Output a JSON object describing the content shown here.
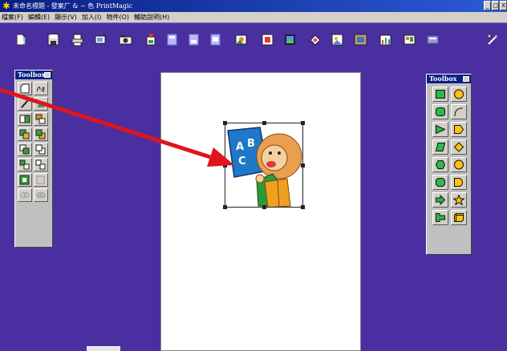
{
  "window": {
    "title": "未命名標題 - 發案厂 & ~ 色 PrintMagic",
    "controls": [
      "_",
      "□",
      "X"
    ]
  },
  "menu": [
    "檔案(F)",
    "編輯(E)",
    "顯示(V)",
    "加入(I)",
    "物件(O)",
    "輔助說明(H)"
  ],
  "toolbar": {
    "icons": [
      "new-icon",
      "save-icon",
      "print-icon",
      "scan-icon",
      "camera-icon",
      "paint-icon",
      "doc-icon",
      "doc2-icon",
      "doc3-icon",
      "photo-icon",
      "frame-icon",
      "image-icon",
      "sticker-icon",
      "picture-icon",
      "frame2-icon",
      "chart-icon",
      "card-icon",
      "banner-icon",
      "magic-icon"
    ]
  },
  "left_toolbox": {
    "title": "Toolbox"
  },
  "right_toolbox": {
    "title": "Toolbox"
  },
  "colors": {
    "desktop": "#4a2fa0",
    "toolbox_face": "#c0c0c0",
    "shape_green": "#2db84a",
    "shape_yellow": "#ffc20e",
    "arrow": "#e0141c"
  }
}
